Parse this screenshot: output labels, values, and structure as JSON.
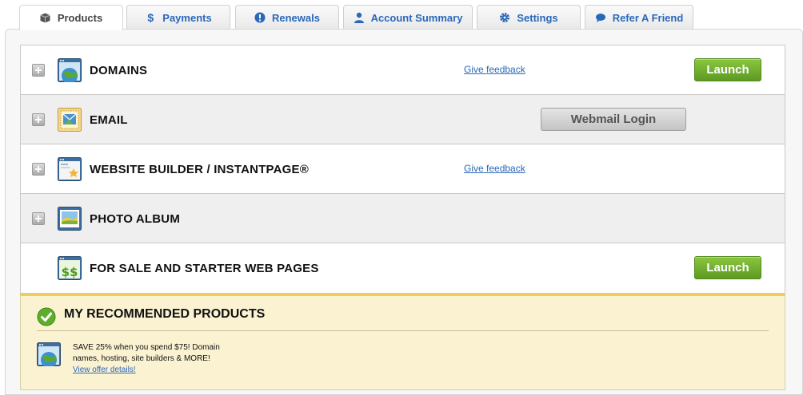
{
  "tabs": [
    {
      "label": "Products",
      "icon": "box-icon",
      "active": true
    },
    {
      "label": "Payments",
      "icon": "dollar-icon",
      "active": false
    },
    {
      "label": "Renewals",
      "icon": "alert-icon",
      "active": false
    },
    {
      "label": "Account Summary",
      "icon": "user-icon",
      "active": false
    },
    {
      "label": "Settings",
      "icon": "gear-icon",
      "active": false
    },
    {
      "label": "Refer A Friend",
      "icon": "speech-bubble-icon",
      "active": false
    }
  ],
  "products": [
    {
      "name": "DOMAINS",
      "icon": "globe-window-icon",
      "feedback": "Give feedback",
      "button": "Launch"
    },
    {
      "name": "EMAIL",
      "icon": "email-stamp-icon",
      "button": "Webmail Login"
    },
    {
      "name": "WEBSITE BUILDER / INSTANTPAGE®",
      "icon": "website-builder-icon",
      "feedback": "Give feedback"
    },
    {
      "name": "PHOTO ALBUM",
      "icon": "photo-album-icon"
    },
    {
      "name": "FOR SALE AND STARTER WEB PAGES",
      "icon": "dollar-window-icon",
      "button": "Launch"
    }
  ],
  "recommended": {
    "title": "MY RECOMMENDED PRODUCTS",
    "offer_text": "SAVE 25% when you spend $75! Domain names, hosting, site builders & MORE!",
    "offer_link": "View offer details!"
  },
  "colors": {
    "tab_link": "#2b68b8",
    "launch_green": "#6aaa2c",
    "recommended_bg": "#fbf2d1",
    "recommended_border": "#f2cc56"
  }
}
